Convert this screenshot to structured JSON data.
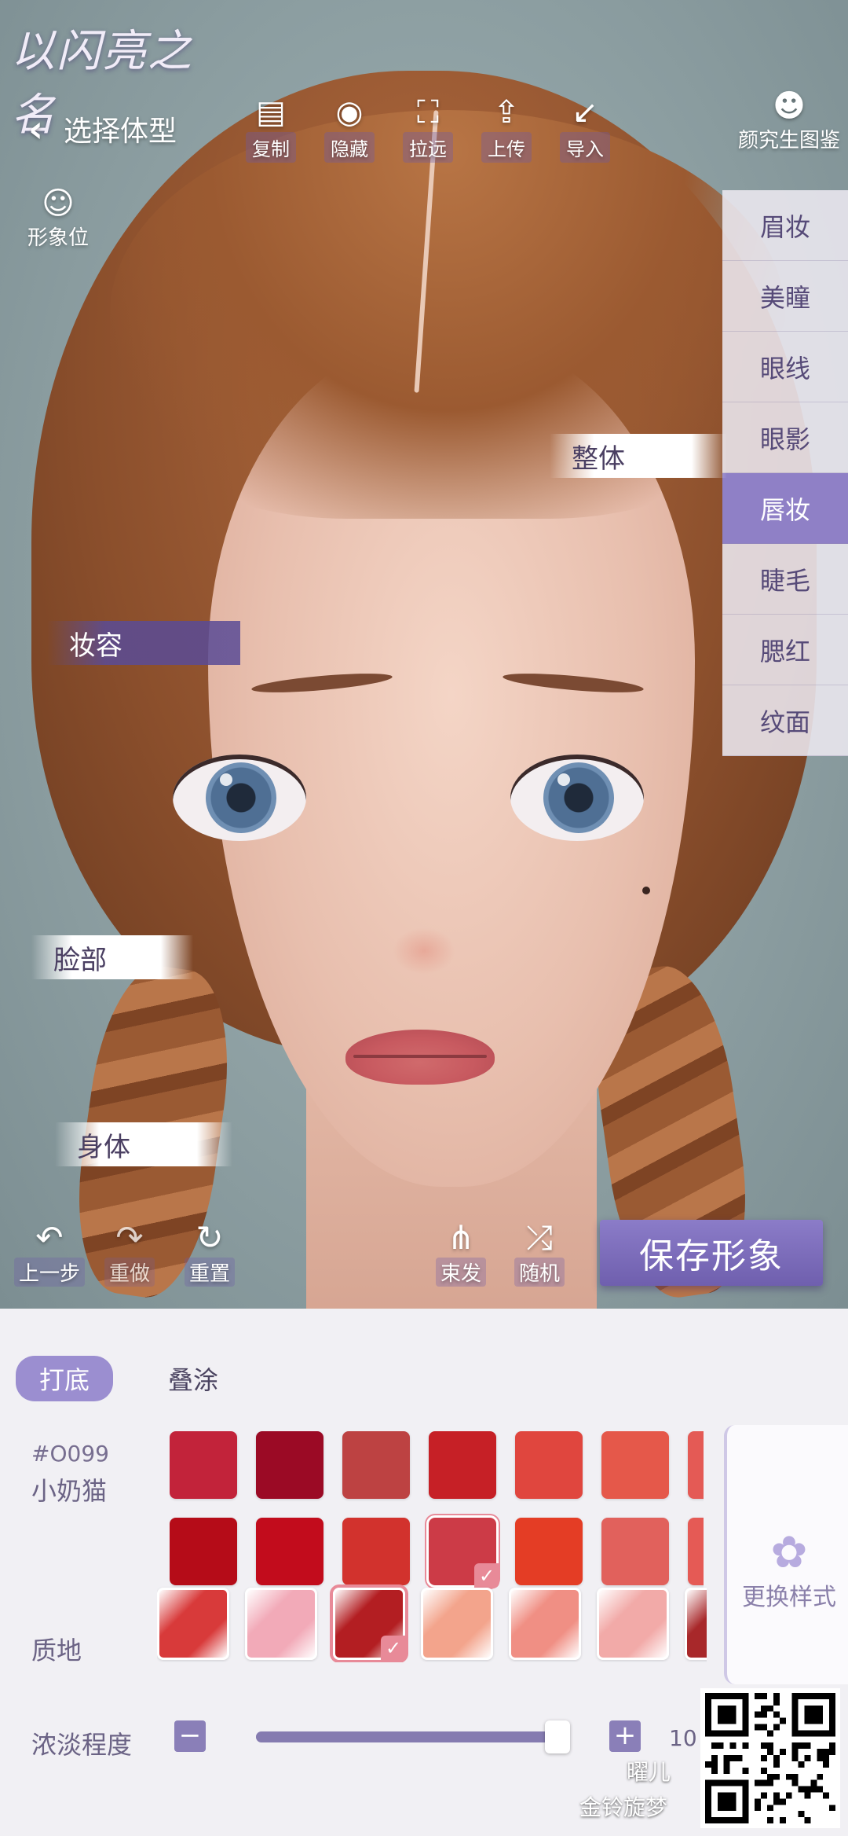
{
  "app": {
    "logo_text": "以闪亮之名"
  },
  "header": {
    "back_label": "选择体型"
  },
  "toolbar": {
    "copy": {
      "label": "复制",
      "icon": "copy-icon"
    },
    "hide": {
      "label": "隐藏",
      "icon": "eye-icon"
    },
    "zoom_out": {
      "label": "拉远",
      "icon": "expand-icon"
    },
    "upload": {
      "label": "上传",
      "icon": "upload-icon"
    },
    "import": {
      "label": "导入",
      "icon": "import-icon"
    }
  },
  "side": {
    "avatar_slot": "形象位",
    "gallery": "颜究生图鉴"
  },
  "categories": [
    "眉妆",
    "美瞳",
    "眼线",
    "眼影",
    "唇妆",
    "睫毛",
    "腮红",
    "纹面"
  ],
  "active_category": "唇妆",
  "section_tags": {
    "whole": "整体",
    "makeup": "妆容",
    "face": "脸部",
    "body": "身体"
  },
  "bottom_tools": {
    "undo": "上一步",
    "redo": "重做",
    "reset": "重置",
    "tie_hair": "束发",
    "random": "随机"
  },
  "save_label": "保存形象",
  "panel": {
    "tabs": [
      "打底",
      "叠涂"
    ],
    "active_tab": "打底",
    "shade_code": "#O099",
    "shade_name": "小奶猫",
    "swatch_rows": [
      [
        "#c2233a",
        "#9b0a25",
        "#bd4242",
        "#c62026",
        "#e0463e",
        "#e5584a",
        "#e45a55"
      ],
      [
        "#b50c18",
        "#c20c1c",
        "#d2322d",
        "#cc3b47",
        "#e43d25",
        "#e1615c",
        "#e55a55"
      ]
    ],
    "selected_swatch": {
      "row": 1,
      "index": 3
    },
    "change_style": "更换样式",
    "texture_label": "质地",
    "textures": [
      "#d83a3a",
      "#f2aab8",
      "#b31e22",
      "#f3a48c",
      "#f08f84",
      "#f2aaa8",
      "#a8282a"
    ],
    "selected_texture": 2,
    "intensity_label": "浓淡程度",
    "intensity_value_text": "10",
    "intensity_fraction": 1.0
  },
  "watermark": {
    "line1": "曜儿",
    "line2": "金铃旋梦"
  }
}
